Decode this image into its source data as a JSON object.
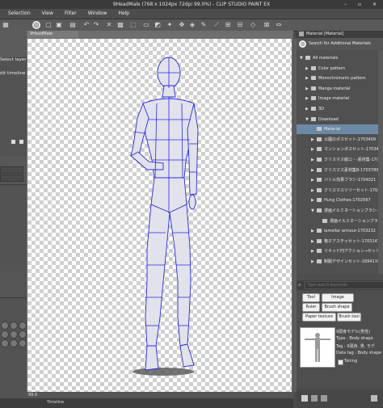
{
  "window": {
    "title": "9HeadMale (768 x 1024px 72dpi 99.0%) - CLIP STUDIO PAINT EX",
    "controls": "– ▫ ✕"
  },
  "menu": [
    "Selection",
    "View",
    "Filter",
    "Window",
    "Help"
  ],
  "left_panel": {
    "layer_hint": "Select layer",
    "timeline_hint": "dit timeline"
  },
  "document": {
    "tab_label": "9HeadMale",
    "zoom": "99.0",
    "timeline_label": "Timeline"
  },
  "materials": {
    "header": "Material [Material]",
    "search_label": "Search for Additional Materials",
    "keyword_placeholder": "Type search keywords",
    "tree": [
      {
        "label": "All materials",
        "depth": 0,
        "arrow": "▼"
      },
      {
        "label": "Color pattern",
        "depth": 1,
        "arrow": "▶"
      },
      {
        "label": "Monochromatic pattern",
        "depth": 1,
        "arrow": "▶"
      },
      {
        "label": "Manga material",
        "depth": 1,
        "arrow": "▶"
      },
      {
        "label": "Image material",
        "depth": 1,
        "arrow": "▶"
      },
      {
        "label": "3D",
        "depth": 1,
        "arrow": "▶"
      },
      {
        "label": "Download",
        "depth": 1,
        "arrow": "▼"
      },
      {
        "label": "Material",
        "depth": 2,
        "arrow": "",
        "selected": true
      },
      {
        "label": "公園のポスセット-1703409",
        "depth": 2,
        "arrow": "▶"
      },
      {
        "label": "マンションポスセット-1703466",
        "depth": 2,
        "arrow": "▶"
      },
      {
        "label": "クリスマス紙ロ・-素材集-17(",
        "depth": 2,
        "arrow": "▶"
      },
      {
        "label": "クリスマス素材集B-1703780",
        "depth": 2,
        "arrow": "▶"
      },
      {
        "label": "バトル効果ブラシ-1704021",
        "depth": 2,
        "arrow": "▶"
      },
      {
        "label": "クリスマスツリーセット-1704218",
        "depth": 2,
        "arrow": "▶"
      },
      {
        "label": "Hung Clothes-1702567",
        "depth": 2,
        "arrow": "▶"
      },
      {
        "label": "漫画イルミネーションブラシ-17(",
        "depth": 2,
        "arrow": "▼"
      },
      {
        "label": "漫画イルミネーションブラ",
        "depth": 3,
        "arrow": ""
      },
      {
        "label": "lamellar armour-1703232",
        "depth": 2,
        "arrow": "▶"
      },
      {
        "label": "格子アスチャセット-1703147",
        "depth": 2,
        "arrow": "▶"
      },
      {
        "label": "リキッド円アクション→セット",
        "depth": 2,
        "arrow": "▶"
      },
      {
        "label": "制服デザインセット-1694119",
        "depth": 2,
        "arrow": "▶"
      }
    ],
    "tags": [
      "Tool",
      "Image material",
      "Ruler",
      "Brush shape",
      "Paper texture",
      "Brush tool"
    ],
    "selected_item": {
      "name": "9頭身モデル(男性)",
      "type": "Type : Body shape",
      "tag": "Tag : 9頭身, 男, モデ",
      "datatag": "Data tag : Body shape",
      "toning": "Toning"
    }
  },
  "colors": {
    "accent_selection": "#6c8aa6",
    "model_wire": "#2a2ae0"
  }
}
